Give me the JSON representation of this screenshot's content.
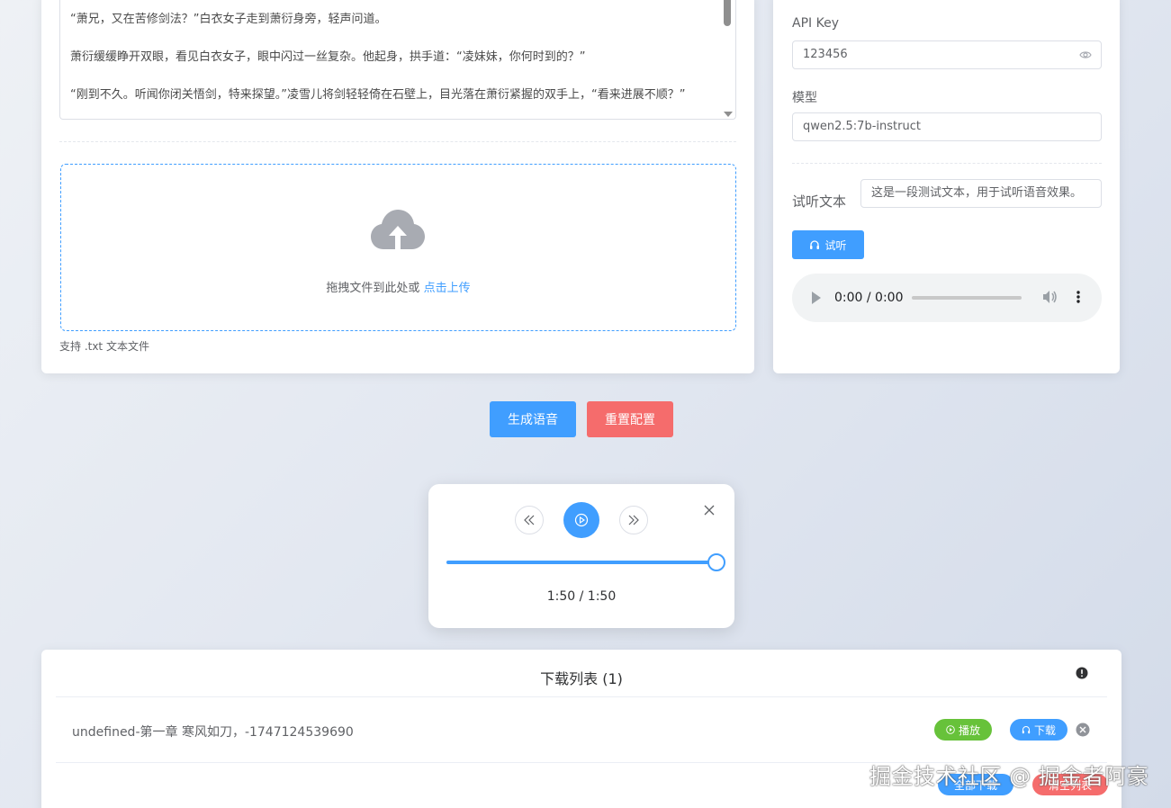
{
  "novel_text": {
    "paragraphs": [
      "“萧兄，又在苦修剑法？”白衣女子走到萧衍身旁，轻声问道。",
      "萧衍缓缓睁开双眼，看见白衣女子，眼中闪过一丝复杂。他起身，拱手道：“凌妹妹，你何时到的？”",
      "“刚到不久。听闻你闭关悟剑，特来探望。”凌雪儿将剑轻轻倚在石壁上，目光落在萧衍紧握的双手上，“看来进展不顺？”"
    ]
  },
  "upload": {
    "prompt": "拖拽文件到此处或",
    "link": "点击上传",
    "tip": "支持 .txt 文本文件"
  },
  "settings": {
    "api_key_label": "API Key",
    "api_key_value": "123456",
    "model_label": "模型",
    "model_value": "qwen2.5:7b-instruct",
    "preview_label": "试听文本",
    "preview_value": "这是一段测试文本，用于试听语音效果。",
    "listen_button": "试听",
    "audio_time": "0:00 / 0:00"
  },
  "actions": {
    "generate": "生成语音",
    "reset": "重置配置"
  },
  "player": {
    "time": "1:50 / 1:50",
    "progress": 1.0
  },
  "download_list": {
    "title": "下载列表 (1)",
    "items": [
      {
        "name": "undefined-第一章 寒风如刀，-1747124539690",
        "play_label": "播放",
        "download_label": "下载"
      }
    ],
    "download_all": "全部下载",
    "clear_list": "清空列表"
  },
  "watermark": "掘金技术社区 @ 掘金者阿豪",
  "colors": {
    "primary": "#409eff",
    "danger": "#f56c6c",
    "success": "#67c23a"
  }
}
